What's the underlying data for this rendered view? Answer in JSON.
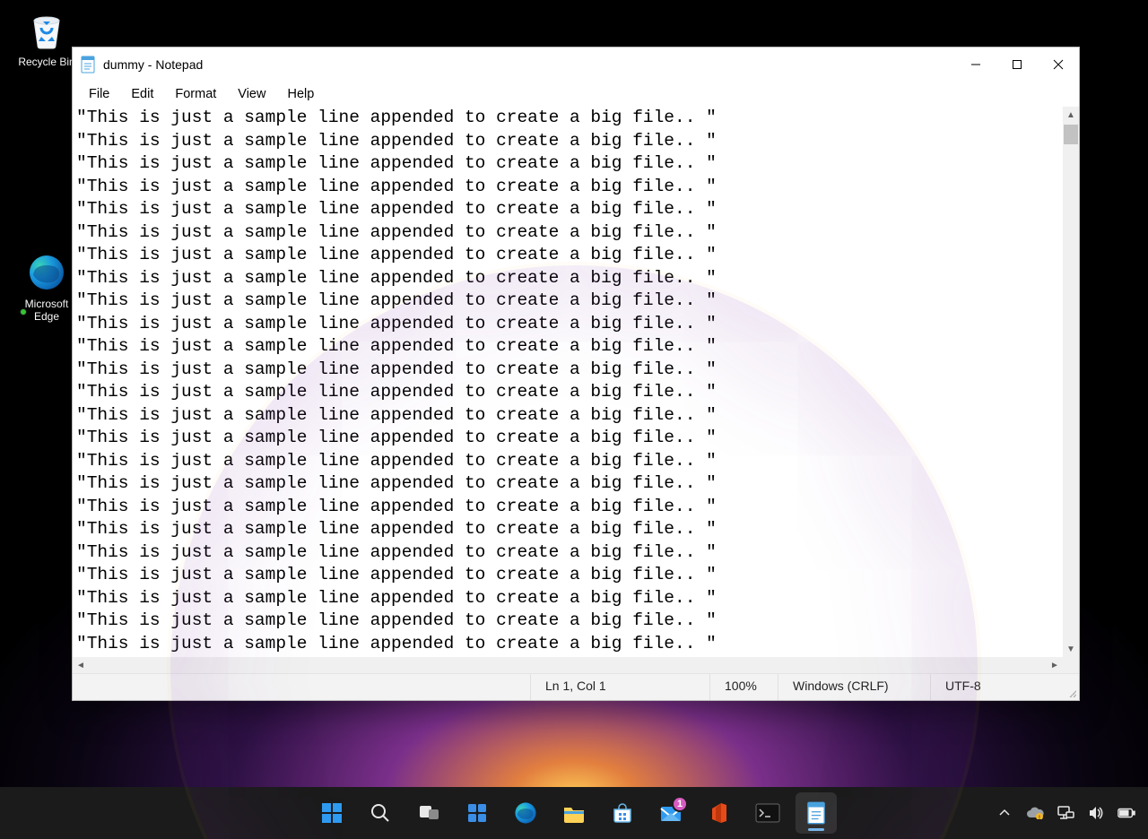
{
  "desktop": {
    "icons": {
      "recycle_bin": "Recycle Bin",
      "edge": "Microsoft Edge"
    }
  },
  "notepad": {
    "title": "dummy - Notepad",
    "menu": [
      "File",
      "Edit",
      "Format",
      "View",
      "Help"
    ],
    "text_line": "\"This is just a sample line appended to create a big file.. \" ",
    "line_count": 24,
    "status": {
      "position": "Ln 1, Col 1",
      "zoom": "100%",
      "eol": "Windows (CRLF)",
      "encoding": "UTF-8"
    }
  },
  "taskbar": {
    "mail_badge": "1"
  }
}
